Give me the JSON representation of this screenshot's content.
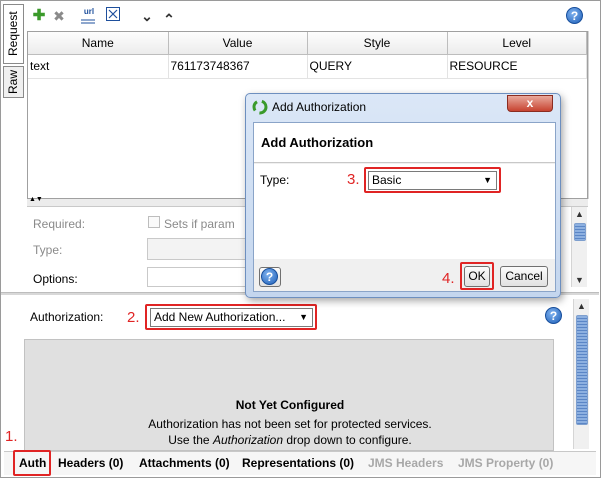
{
  "side_tabs": [
    "Request",
    "Raw"
  ],
  "toolbar": {
    "icons": [
      "add-icon",
      "delete-icon",
      "url-icon",
      "sort-icon",
      "move-down-icon",
      "move-up-icon",
      "help-icon"
    ],
    "add": "✚",
    "del": "✖",
    "url": "url",
    "down": "⌄",
    "up": "⌃",
    "help": "?"
  },
  "grid": {
    "columns": [
      "Name",
      "Value",
      "Style",
      "Level"
    ],
    "rows": [
      [
        "text",
        "761173748367",
        "QUERY",
        "RESOURCE"
      ]
    ]
  },
  "props": {
    "required_label": "Required:",
    "required_check": "Sets if param",
    "type_label": "Type:",
    "options_label": "Options:",
    "collapse": "▲▼"
  },
  "auth": {
    "label": "Authorization:",
    "step": "2.",
    "dropdown": "Add New Authorization...",
    "panel_title": "Not Yet Configured",
    "panel_line1": "Authorization has not been set for protected services.",
    "panel_line2_pre": "Use the ",
    "panel_line2_em": "Authorization",
    "panel_line2_post": " drop down to configure.",
    "help": "?"
  },
  "bottom_tabs": {
    "step": "1.",
    "items": [
      "Auth",
      "Headers (0)",
      "Attachments (0)",
      "Representations (0)",
      "JMS Headers",
      "JMS Property (0)"
    ]
  },
  "dialog": {
    "title": "Add Authorization",
    "close": "x",
    "heading": "Add Authorization",
    "type_label": "Type:",
    "step3": "3.",
    "type_value": "Basic",
    "help": "?",
    "step4": "4.",
    "ok": "OK",
    "cancel": "Cancel"
  },
  "colors": {
    "accent_red": "#e02424",
    "help_blue": "#1e5fb8",
    "add_green": "#3a9a2a"
  }
}
